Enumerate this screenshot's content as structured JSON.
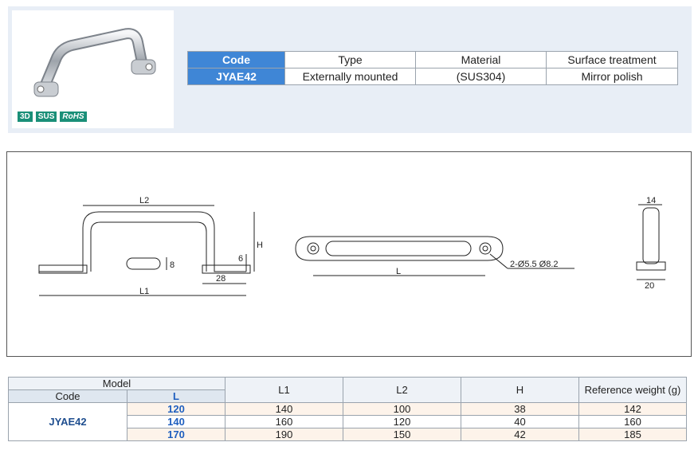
{
  "badges": [
    "3D",
    "SUS",
    "RoHS"
  ],
  "spec_table": {
    "headers": [
      "Code",
      "Type",
      "Material",
      "Surface treatment"
    ],
    "row": [
      "JYAE42",
      "Externally mounted",
      "(SUS304)",
      "Mirror polish"
    ]
  },
  "drawing": {
    "L2": "L2",
    "L1": "L1",
    "H": "H",
    "dim_28": "28",
    "dim_8": "8",
    "dim_6": "6",
    "L": "L",
    "holes": "2-Ø5.5  Ø8.2",
    "dim_14": "14",
    "dim_20": "20"
  },
  "model_table": {
    "model_label": "Model",
    "code_label": "Code",
    "l_label": "L",
    "l1_label": "L1",
    "l2_label": "L2",
    "h_label": "H",
    "weight_label": "Reference weight (g)",
    "code": "JYAE42",
    "rows": [
      {
        "L": "120",
        "L1": "140",
        "L2": "100",
        "H": "38",
        "weight": "142"
      },
      {
        "L": "140",
        "L1": "160",
        "L2": "120",
        "H": "40",
        "weight": "160"
      },
      {
        "L": "170",
        "L1": "190",
        "L2": "150",
        "H": "42",
        "weight": "185"
      }
    ]
  }
}
